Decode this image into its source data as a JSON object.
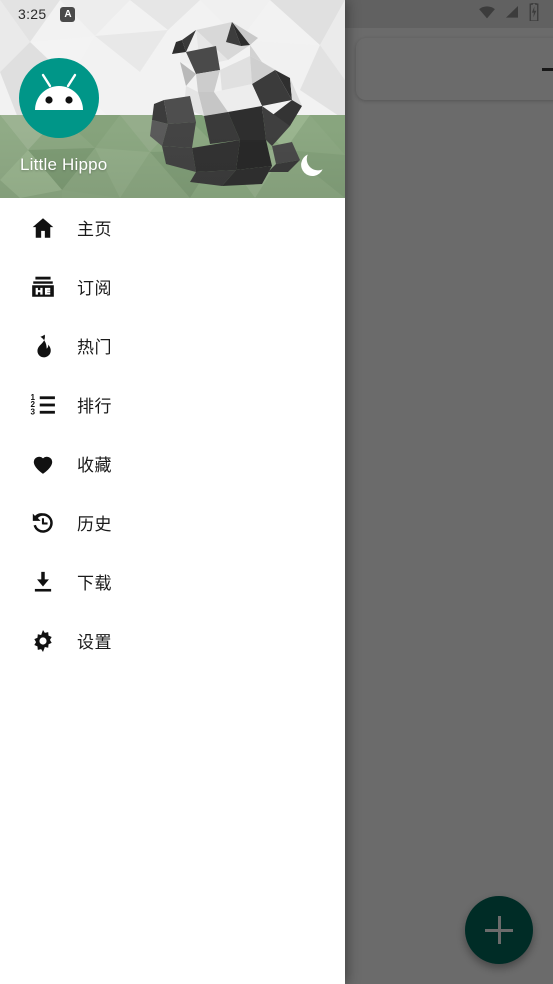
{
  "status_bar": {
    "time": "3:25",
    "notification_badge": "A",
    "icons": [
      "wifi-icon",
      "signal-icon",
      "battery-charging-icon"
    ]
  },
  "drawer": {
    "header": {
      "account_name": "Little Hippo",
      "avatar": "android-robot-avatar",
      "dark_mode_icon": "moon-icon",
      "background": "low-poly-panda-illustration"
    },
    "menu": [
      {
        "label": "主页",
        "icon": "home-icon"
      },
      {
        "label": "订阅",
        "icon": "subscriptions-icon"
      },
      {
        "label": "热门",
        "icon": "flame-icon"
      },
      {
        "label": "排行",
        "icon": "numbered-list-icon"
      },
      {
        "label": "收藏",
        "icon": "heart-icon"
      },
      {
        "label": "历史",
        "icon": "history-clock-icon"
      },
      {
        "label": "下载",
        "icon": "download-icon"
      },
      {
        "label": "设置",
        "icon": "gear-icon"
      }
    ]
  },
  "app": {
    "search_bar_add_icon": "plus-icon",
    "fab_icon": "plus-icon"
  },
  "colors": {
    "accent_teal": "#009688",
    "fab_teal": "#00695c",
    "drawer_bg": "#ffffff",
    "scrim": "rgba(0,0,0,0.58)",
    "grass_green": "#8ca882"
  }
}
